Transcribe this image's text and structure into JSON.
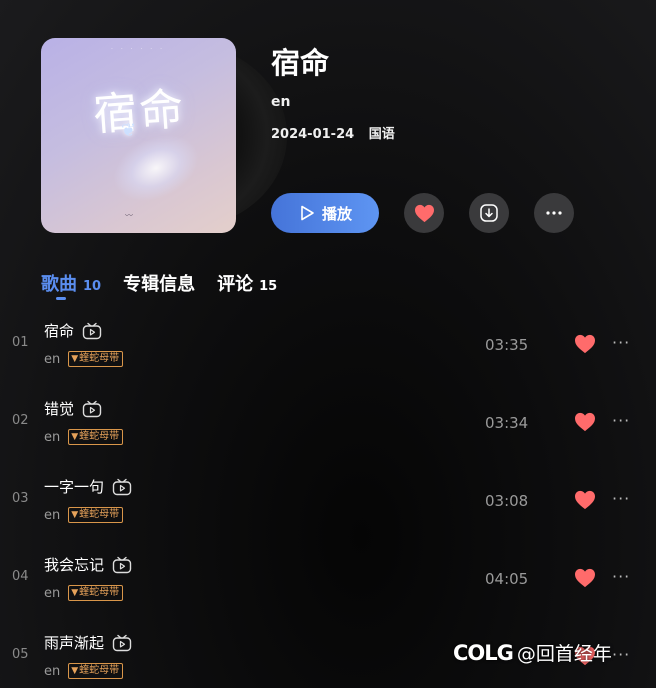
{
  "album": {
    "title": "宿命",
    "artist": "en",
    "date": "2024-01-24",
    "language": "国语",
    "cover_text": "宿命"
  },
  "actions": {
    "play_label": "播放",
    "like_color": "#ff6b6b",
    "accent_color": "#5b8ef0"
  },
  "tabs": [
    {
      "label": "歌曲",
      "count": "10",
      "active": true
    },
    {
      "label": "专辑信息",
      "count": "",
      "active": false
    },
    {
      "label": "评论",
      "count": "15",
      "active": false
    }
  ],
  "songs": [
    {
      "index": "01",
      "name": "宿命",
      "artist": "en",
      "badge": "蝰蛇母带",
      "duration": "03:35",
      "liked": true
    },
    {
      "index": "02",
      "name": "错觉",
      "artist": "en",
      "badge": "蝰蛇母带",
      "duration": "03:34",
      "liked": true
    },
    {
      "index": "03",
      "name": "一字一句",
      "artist": "en",
      "badge": "蝰蛇母带",
      "duration": "03:08",
      "liked": true
    },
    {
      "index": "04",
      "name": "我会忘记",
      "artist": "en",
      "badge": "蝰蛇母带",
      "duration": "04:05",
      "liked": true
    },
    {
      "index": "05",
      "name": "雨声渐起",
      "artist": "en",
      "badge": "蝰蛇母带",
      "duration": "",
      "liked": true
    }
  ],
  "icons": {
    "play": "play-icon",
    "like": "heart-icon",
    "download": "download-icon",
    "more": "more-icon",
    "mv": "tv-icon"
  },
  "watermark": {
    "logo": "COLG",
    "handle": "@回首经年"
  }
}
